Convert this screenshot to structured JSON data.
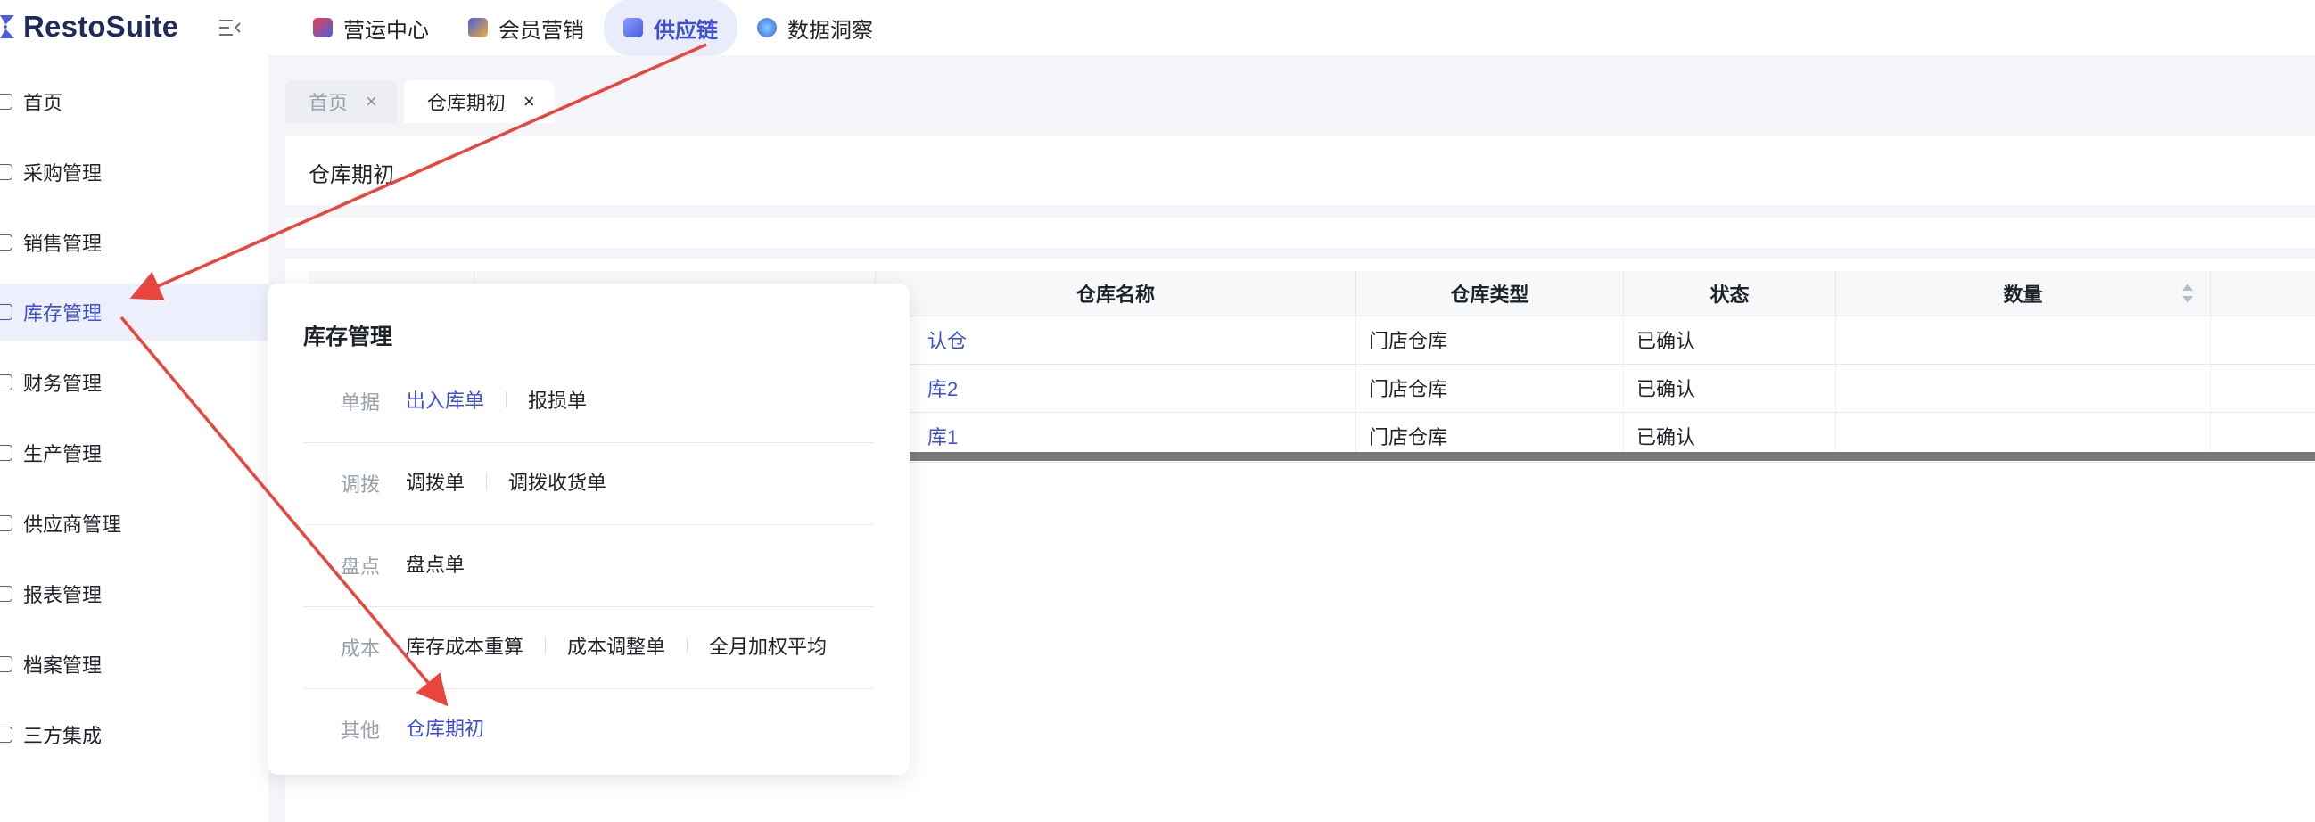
{
  "app": {
    "logo_text": "RestoSuite"
  },
  "top_nav": [
    {
      "label": "营运中心",
      "color": "#e8434b",
      "active": false
    },
    {
      "label": "会员营销",
      "color": "#f2b233",
      "active": false
    },
    {
      "label": "供应链",
      "color": "#4a5ce0",
      "active": true
    },
    {
      "label": "数据洞察",
      "color": "#3b82f6",
      "active": false
    }
  ],
  "sidebar": {
    "items": [
      {
        "label": "首页"
      },
      {
        "label": "采购管理"
      },
      {
        "label": "销售管理"
      },
      {
        "label": "库存管理",
        "active": true
      },
      {
        "label": "财务管理"
      },
      {
        "label": "生产管理"
      },
      {
        "label": "供应商管理"
      },
      {
        "label": "报表管理"
      },
      {
        "label": "档案管理"
      },
      {
        "label": "三方集成"
      }
    ]
  },
  "tabs": [
    {
      "label": "首页",
      "close": "×"
    },
    {
      "label": "仓库期初",
      "close": "×"
    }
  ],
  "page": {
    "title": "仓库期初"
  },
  "table": {
    "columns": [
      "仓库名称",
      "仓库类型",
      "状态",
      "数量"
    ],
    "rows": [
      {
        "name": "认仓",
        "type": "门店仓库",
        "status": "已确认",
        "qty": ""
      },
      {
        "name": "库2",
        "type": "门店仓库",
        "status": "已确认",
        "qty": ""
      },
      {
        "name": "库1",
        "type": "门店仓库",
        "status": "已确认",
        "qty": ""
      }
    ]
  },
  "flyout": {
    "title": "库存管理",
    "groups": [
      {
        "name": "单据",
        "items": [
          {
            "label": "出入库单",
            "active": true
          },
          {
            "label": "报损单"
          }
        ]
      },
      {
        "name": "调拨",
        "items": [
          {
            "label": "调拨单"
          },
          {
            "label": "调拨收货单"
          }
        ]
      },
      {
        "name": "盘点",
        "items": [
          {
            "label": "盘点单"
          }
        ]
      },
      {
        "name": "成本",
        "items": [
          {
            "label": "库存成本重算"
          },
          {
            "label": "成本调整单"
          },
          {
            "label": "全月加权平均"
          }
        ]
      },
      {
        "name": "其他",
        "items": [
          {
            "label": "仓库期初",
            "active": true
          }
        ]
      }
    ]
  },
  "colors": {
    "accent": "#3e4fd6",
    "annotation": "#e8453c"
  }
}
